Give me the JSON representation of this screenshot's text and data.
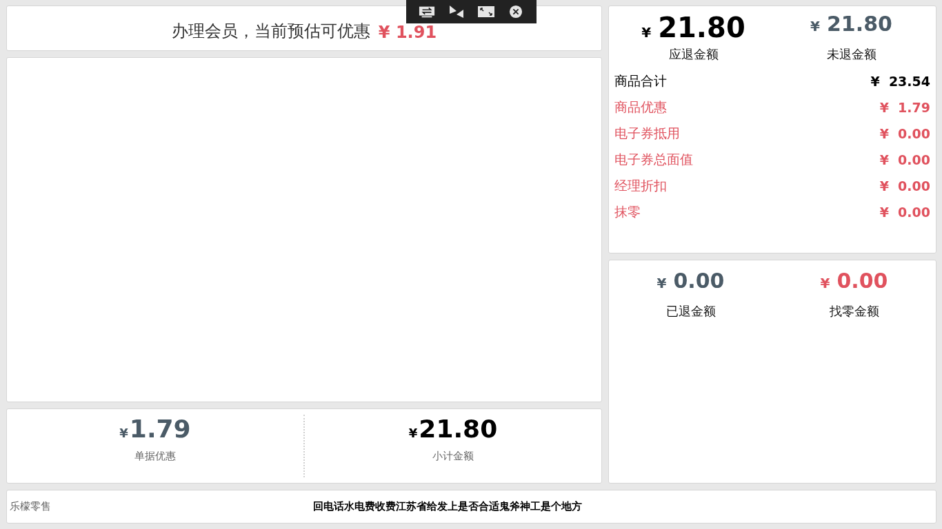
{
  "promo": {
    "text": "办理会员，当前预估可优惠",
    "amount": "¥ 1.91"
  },
  "toolbar": [
    {
      "kind": "swap"
    },
    {
      "kind": "mirror"
    },
    {
      "kind": "resize"
    },
    {
      "kind": "close"
    }
  ],
  "bill_totals": [
    {
      "amount": "1.79",
      "currency": "¥",
      "label": "单据优惠",
      "color": "#4b5b67"
    },
    {
      "amount": "21.80",
      "currency": "¥",
      "label": "小计金额",
      "color": "#000000"
    }
  ],
  "refund_summary": [
    {
      "amount": "21.80",
      "currency": "¥",
      "label": "应退金额",
      "color": "#000000"
    },
    {
      "amount": "21.80",
      "currency": "¥",
      "label": "未退金额",
      "color": "#4b5b67"
    }
  ],
  "breakdown": [
    {
      "label": "商品合计",
      "value": "¥  23.54",
      "kind": "total"
    },
    {
      "label": "商品优惠",
      "value": "¥  1.79",
      "kind": "discount"
    },
    {
      "label": "电子券抵用",
      "value": "¥  0.00",
      "kind": "discount"
    },
    {
      "label": "电子券总面值",
      "value": "¥  0.00",
      "kind": "discount"
    },
    {
      "label": "经理折扣",
      "value": "¥  0.00",
      "kind": "discount"
    },
    {
      "label": "抹零",
      "value": "¥  0.00",
      "kind": "discount"
    }
  ],
  "payment": [
    {
      "amount": "0.00",
      "currency": "¥",
      "label": "已退金额",
      "color": "#4b5b67"
    },
    {
      "amount": "0.00",
      "currency": "¥",
      "label": "找零金额",
      "color": "#e0525e"
    }
  ],
  "footer": {
    "brand": "乐檬零售",
    "message": "回电话水电费收费江苏省给发上是否合适鬼斧神工是个地方"
  }
}
